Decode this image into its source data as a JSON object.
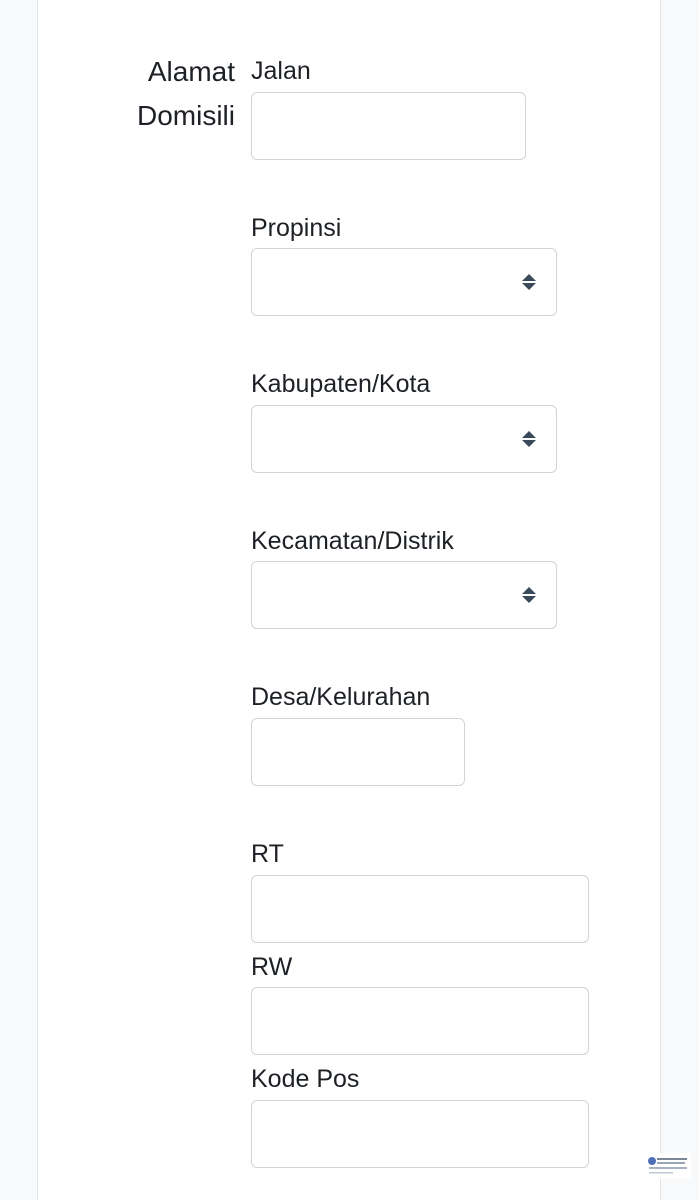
{
  "section": {
    "title_line1": "Alamat",
    "title_line2": "Domisili"
  },
  "fields": {
    "jalan": {
      "label": "Jalan",
      "value": ""
    },
    "propinsi": {
      "label": "Propinsi",
      "value": ""
    },
    "kabupaten": {
      "label": "Kabupaten/Kota",
      "value": ""
    },
    "kecamatan": {
      "label": "Kecamatan/Distrik",
      "value": ""
    },
    "desa": {
      "label": "Desa/Kelurahan",
      "value": ""
    },
    "rt": {
      "label": "RT",
      "value": ""
    },
    "rw": {
      "label": "RW",
      "value": ""
    },
    "kode_pos": {
      "label": "Kode Pos",
      "value": ""
    }
  },
  "icons": {
    "select_arrows": "sort-arrows-icon"
  },
  "colors": {
    "text": "#1d2125",
    "border": "#ced4da",
    "arrow": "#3b4a5a"
  }
}
